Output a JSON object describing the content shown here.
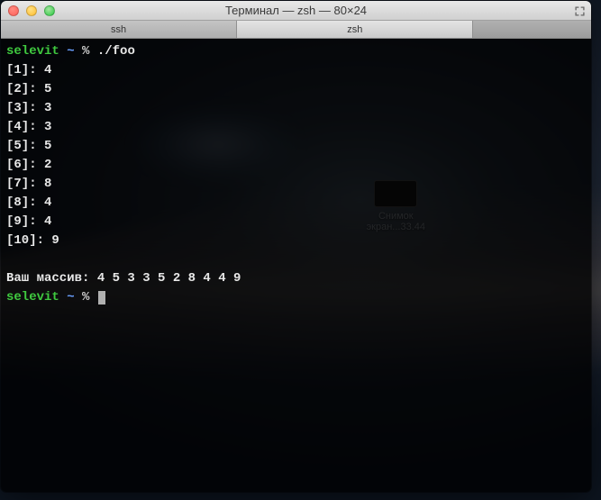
{
  "window": {
    "title": "Терминал — zsh — 80×24"
  },
  "tabs": [
    {
      "label": "ssh",
      "active": false
    },
    {
      "label": "zsh",
      "active": true
    }
  ],
  "desktop": {
    "icon_label_line1": "Снимок",
    "icon_label_line2": "экран...33.44"
  },
  "terminal": {
    "prompt_user": "selevit",
    "prompt_tilde": "~",
    "prompt_symbol": "%",
    "command": "./foo",
    "lines": [
      "[1]: 4",
      "[2]: 5",
      "[3]: 3",
      "[4]: 3",
      "[5]: 5",
      "[6]: 2",
      "[7]: 8",
      "[8]: 4",
      "[9]: 4",
      "[10]: 9",
      "",
      "Ваш массив: 4 5 3 3 5 2 8 4 4 9"
    ]
  }
}
